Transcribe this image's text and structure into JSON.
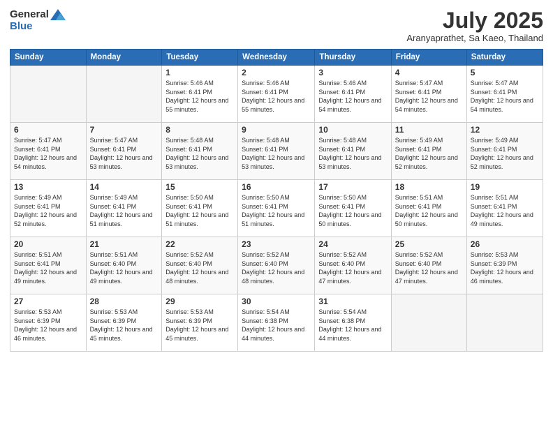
{
  "logo": {
    "general": "General",
    "blue": "Blue"
  },
  "title": "July 2025",
  "location": "Aranyaprathet, Sa Kaeo, Thailand",
  "days_of_week": [
    "Sunday",
    "Monday",
    "Tuesday",
    "Wednesday",
    "Thursday",
    "Friday",
    "Saturday"
  ],
  "weeks": [
    [
      {
        "day": "",
        "empty": true
      },
      {
        "day": "",
        "empty": true
      },
      {
        "day": "1",
        "sunrise": "Sunrise: 5:46 AM",
        "sunset": "Sunset: 6:41 PM",
        "daylight": "Daylight: 12 hours and 55 minutes."
      },
      {
        "day": "2",
        "sunrise": "Sunrise: 5:46 AM",
        "sunset": "Sunset: 6:41 PM",
        "daylight": "Daylight: 12 hours and 55 minutes."
      },
      {
        "day": "3",
        "sunrise": "Sunrise: 5:46 AM",
        "sunset": "Sunset: 6:41 PM",
        "daylight": "Daylight: 12 hours and 54 minutes."
      },
      {
        "day": "4",
        "sunrise": "Sunrise: 5:47 AM",
        "sunset": "Sunset: 6:41 PM",
        "daylight": "Daylight: 12 hours and 54 minutes."
      },
      {
        "day": "5",
        "sunrise": "Sunrise: 5:47 AM",
        "sunset": "Sunset: 6:41 PM",
        "daylight": "Daylight: 12 hours and 54 minutes."
      }
    ],
    [
      {
        "day": "6",
        "sunrise": "Sunrise: 5:47 AM",
        "sunset": "Sunset: 6:41 PM",
        "daylight": "Daylight: 12 hours and 54 minutes."
      },
      {
        "day": "7",
        "sunrise": "Sunrise: 5:47 AM",
        "sunset": "Sunset: 6:41 PM",
        "daylight": "Daylight: 12 hours and 53 minutes."
      },
      {
        "day": "8",
        "sunrise": "Sunrise: 5:48 AM",
        "sunset": "Sunset: 6:41 PM",
        "daylight": "Daylight: 12 hours and 53 minutes."
      },
      {
        "day": "9",
        "sunrise": "Sunrise: 5:48 AM",
        "sunset": "Sunset: 6:41 PM",
        "daylight": "Daylight: 12 hours and 53 minutes."
      },
      {
        "day": "10",
        "sunrise": "Sunrise: 5:48 AM",
        "sunset": "Sunset: 6:41 PM",
        "daylight": "Daylight: 12 hours and 53 minutes."
      },
      {
        "day": "11",
        "sunrise": "Sunrise: 5:49 AM",
        "sunset": "Sunset: 6:41 PM",
        "daylight": "Daylight: 12 hours and 52 minutes."
      },
      {
        "day": "12",
        "sunrise": "Sunrise: 5:49 AM",
        "sunset": "Sunset: 6:41 PM",
        "daylight": "Daylight: 12 hours and 52 minutes."
      }
    ],
    [
      {
        "day": "13",
        "sunrise": "Sunrise: 5:49 AM",
        "sunset": "Sunset: 6:41 PM",
        "daylight": "Daylight: 12 hours and 52 minutes."
      },
      {
        "day": "14",
        "sunrise": "Sunrise: 5:49 AM",
        "sunset": "Sunset: 6:41 PM",
        "daylight": "Daylight: 12 hours and 51 minutes."
      },
      {
        "day": "15",
        "sunrise": "Sunrise: 5:50 AM",
        "sunset": "Sunset: 6:41 PM",
        "daylight": "Daylight: 12 hours and 51 minutes."
      },
      {
        "day": "16",
        "sunrise": "Sunrise: 5:50 AM",
        "sunset": "Sunset: 6:41 PM",
        "daylight": "Daylight: 12 hours and 51 minutes."
      },
      {
        "day": "17",
        "sunrise": "Sunrise: 5:50 AM",
        "sunset": "Sunset: 6:41 PM",
        "daylight": "Daylight: 12 hours and 50 minutes."
      },
      {
        "day": "18",
        "sunrise": "Sunrise: 5:51 AM",
        "sunset": "Sunset: 6:41 PM",
        "daylight": "Daylight: 12 hours and 50 minutes."
      },
      {
        "day": "19",
        "sunrise": "Sunrise: 5:51 AM",
        "sunset": "Sunset: 6:41 PM",
        "daylight": "Daylight: 12 hours and 49 minutes."
      }
    ],
    [
      {
        "day": "20",
        "sunrise": "Sunrise: 5:51 AM",
        "sunset": "Sunset: 6:41 PM",
        "daylight": "Daylight: 12 hours and 49 minutes."
      },
      {
        "day": "21",
        "sunrise": "Sunrise: 5:51 AM",
        "sunset": "Sunset: 6:40 PM",
        "daylight": "Daylight: 12 hours and 49 minutes."
      },
      {
        "day": "22",
        "sunrise": "Sunrise: 5:52 AM",
        "sunset": "Sunset: 6:40 PM",
        "daylight": "Daylight: 12 hours and 48 minutes."
      },
      {
        "day": "23",
        "sunrise": "Sunrise: 5:52 AM",
        "sunset": "Sunset: 6:40 PM",
        "daylight": "Daylight: 12 hours and 48 minutes."
      },
      {
        "day": "24",
        "sunrise": "Sunrise: 5:52 AM",
        "sunset": "Sunset: 6:40 PM",
        "daylight": "Daylight: 12 hours and 47 minutes."
      },
      {
        "day": "25",
        "sunrise": "Sunrise: 5:52 AM",
        "sunset": "Sunset: 6:40 PM",
        "daylight": "Daylight: 12 hours and 47 minutes."
      },
      {
        "day": "26",
        "sunrise": "Sunrise: 5:53 AM",
        "sunset": "Sunset: 6:39 PM",
        "daylight": "Daylight: 12 hours and 46 minutes."
      }
    ],
    [
      {
        "day": "27",
        "sunrise": "Sunrise: 5:53 AM",
        "sunset": "Sunset: 6:39 PM",
        "daylight": "Daylight: 12 hours and 46 minutes."
      },
      {
        "day": "28",
        "sunrise": "Sunrise: 5:53 AM",
        "sunset": "Sunset: 6:39 PM",
        "daylight": "Daylight: 12 hours and 45 minutes."
      },
      {
        "day": "29",
        "sunrise": "Sunrise: 5:53 AM",
        "sunset": "Sunset: 6:39 PM",
        "daylight": "Daylight: 12 hours and 45 minutes."
      },
      {
        "day": "30",
        "sunrise": "Sunrise: 5:54 AM",
        "sunset": "Sunset: 6:38 PM",
        "daylight": "Daylight: 12 hours and 44 minutes."
      },
      {
        "day": "31",
        "sunrise": "Sunrise: 5:54 AM",
        "sunset": "Sunset: 6:38 PM",
        "daylight": "Daylight: 12 hours and 44 minutes."
      },
      {
        "day": "",
        "empty": true
      },
      {
        "day": "",
        "empty": true
      }
    ]
  ]
}
